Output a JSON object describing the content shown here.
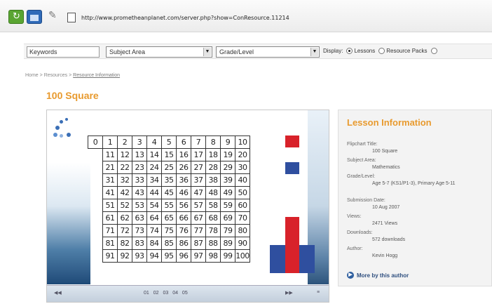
{
  "browser": {
    "url": "http://www.prometheanplanet.com/server.php?show=ConResource.11214"
  },
  "filters": {
    "keywords_label": "Keywords",
    "subject_area": "Subject Area",
    "grade_level": "Grade/Level",
    "display_label": "Display:",
    "display_options": [
      "Lessons",
      "Resource Packs"
    ],
    "display_selected": "Lessons"
  },
  "breadcrumb": {
    "home": "Home",
    "sep": ">",
    "resources": "Resources",
    "current": "Resource Information"
  },
  "page_title": "100 Square",
  "flipchart": {
    "grid": [
      [
        "0",
        "1",
        "2",
        "3",
        "4",
        "5",
        "6",
        "7",
        "8",
        "9",
        "10"
      ],
      [
        "",
        "11",
        "12",
        "13",
        "14",
        "15",
        "16",
        "17",
        "18",
        "19",
        "20"
      ],
      [
        "",
        "21",
        "22",
        "23",
        "24",
        "25",
        "26",
        "27",
        "28",
        "29",
        "30"
      ],
      [
        "",
        "31",
        "32",
        "33",
        "34",
        "35",
        "36",
        "37",
        "38",
        "39",
        "40"
      ],
      [
        "",
        "41",
        "42",
        "43",
        "44",
        "45",
        "46",
        "47",
        "48",
        "49",
        "50"
      ],
      [
        "",
        "51",
        "52",
        "53",
        "54",
        "55",
        "56",
        "57",
        "58",
        "59",
        "60"
      ],
      [
        "",
        "61",
        "62",
        "63",
        "64",
        "65",
        "66",
        "67",
        "68",
        "69",
        "70"
      ],
      [
        "",
        "71",
        "72",
        "73",
        "74",
        "75",
        "76",
        "77",
        "78",
        "79",
        "80"
      ],
      [
        "",
        "81",
        "82",
        "83",
        "84",
        "85",
        "86",
        "87",
        "88",
        "89",
        "90"
      ],
      [
        "",
        "91",
        "92",
        "93",
        "94",
        "95",
        "96",
        "97",
        "98",
        "99",
        "100"
      ]
    ],
    "pages": "01  02  03  04  05",
    "colors": {
      "red": "#d8222a",
      "blue": "#2f4f9f"
    }
  },
  "lesson_info": {
    "heading": "Lesson Information",
    "fields": [
      {
        "label": "Flipchart Title:",
        "value": "100 Square"
      },
      {
        "label": "Subject Area:",
        "value": "Mathematics"
      },
      {
        "label": "Grade/Level:",
        "value": "Age 5-7 (KS1/P1-3), Primary Age 5-11"
      },
      {
        "label": "Submission Date:",
        "value": "10 Aug 2007"
      },
      {
        "label": "Views:",
        "value": "2471 Views"
      },
      {
        "label": "Downloads:",
        "value": "572 downloads"
      },
      {
        "label": "Author:",
        "value": "Kevin Hogg"
      }
    ],
    "more_link": "More by this author"
  }
}
